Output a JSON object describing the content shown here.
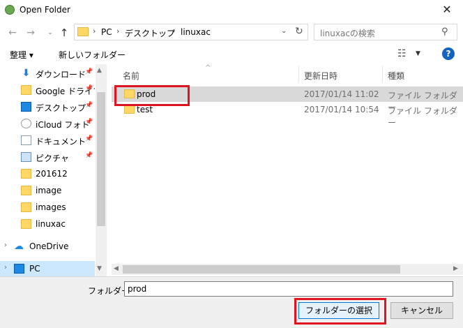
{
  "window": {
    "title": "Open Folder"
  },
  "address": {
    "crumbs": [
      "PC",
      "デスクトップ",
      "linuxac"
    ],
    "search_placeholder": "linuxacの検索"
  },
  "toolbar": {
    "organize_label": "整理 ▾",
    "new_folder_label": "新しいフォルダー"
  },
  "nav": {
    "items": [
      {
        "label": "ダウンロード",
        "icon": "download-icon",
        "pinned": true
      },
      {
        "label": "Google ドライブ",
        "icon": "google-drive-icon",
        "pinned": true
      },
      {
        "label": "デスクトップ",
        "icon": "desktop-icon",
        "pinned": true
      },
      {
        "label": "iCloud フォト",
        "icon": "icloud-photos-icon",
        "pinned": true
      },
      {
        "label": "ドキュメント",
        "icon": "documents-icon",
        "pinned": true
      },
      {
        "label": "ピクチャ",
        "icon": "pictures-icon",
        "pinned": true
      },
      {
        "label": "201612",
        "icon": "folder-icon",
        "pinned": false
      },
      {
        "label": "image",
        "icon": "folder-icon",
        "pinned": false
      },
      {
        "label": "images",
        "icon": "folder-icon",
        "pinned": false
      },
      {
        "label": "linuxac",
        "icon": "folder-icon",
        "pinned": false
      },
      {
        "label": "OneDrive",
        "icon": "onedrive-icon",
        "pinned": false
      },
      {
        "label": "PC",
        "icon": "pc-icon",
        "pinned": false
      }
    ]
  },
  "file_list": {
    "columns": {
      "name": "名前",
      "date": "更新日時",
      "type": "種類"
    },
    "rows": [
      {
        "name": "prod",
        "date": "2017/01/14 11:02",
        "type": "ファイル フォルダー",
        "selected": true
      },
      {
        "name": "test",
        "date": "2017/01/14 10:54",
        "type": "ファイル フォルダー",
        "selected": false
      }
    ]
  },
  "bottom": {
    "folder_label": "フォルダー:",
    "folder_value": "prod",
    "select_label": "フォルダーの選択",
    "cancel_label": "キャンセル"
  },
  "colors": {
    "accent": "#0078d7",
    "highlight_box": "#e0141e",
    "selection": "#d9d9d9"
  }
}
